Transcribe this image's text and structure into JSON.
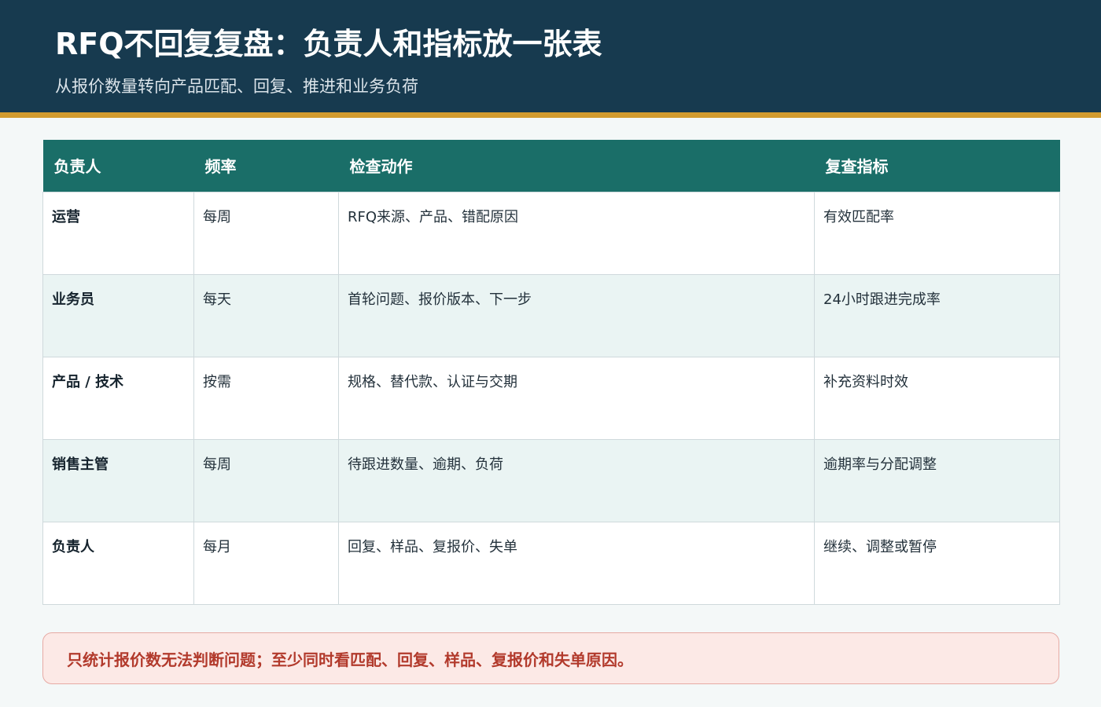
{
  "header": {
    "title": "RFQ不回复复盘：负责人和指标放一张表",
    "subtitle": "从报价数量转向产品匹配、回复、推进和业务负荷"
  },
  "table": {
    "columns": [
      "负责人",
      "频率",
      "检查动作",
      "复查指标"
    ],
    "rows": [
      {
        "owner": "运营",
        "frequency": "每周",
        "action": "RFQ来源、产品、错配原因",
        "metric": "有效匹配率"
      },
      {
        "owner": "业务员",
        "frequency": "每天",
        "action": "首轮问题、报价版本、下一步",
        "metric": "24小时跟进完成率"
      },
      {
        "owner": "产品 / 技术",
        "frequency": "按需",
        "action": "规格、替代款、认证与交期",
        "metric": "补充资料时效"
      },
      {
        "owner": "销售主管",
        "frequency": "每周",
        "action": "待跟进数量、逾期、负荷",
        "metric": "逾期率与分配调整"
      },
      {
        "owner": "负责人",
        "frequency": "每月",
        "action": "回复、样品、复报价、失单",
        "metric": "继续、调整或暂停"
      }
    ]
  },
  "note": {
    "text": "只统计报价数无法判断问题；至少同时看匹配、回复、样品、复报价和失单原因。"
  },
  "colors": {
    "header_bg": "#173a4f",
    "accent_bar": "#d29b2e",
    "table_header_bg": "#1a6e68",
    "row_alt_bg": "#eaf4f3",
    "note_bg": "#fce9e6",
    "note_text": "#b23a2c"
  }
}
